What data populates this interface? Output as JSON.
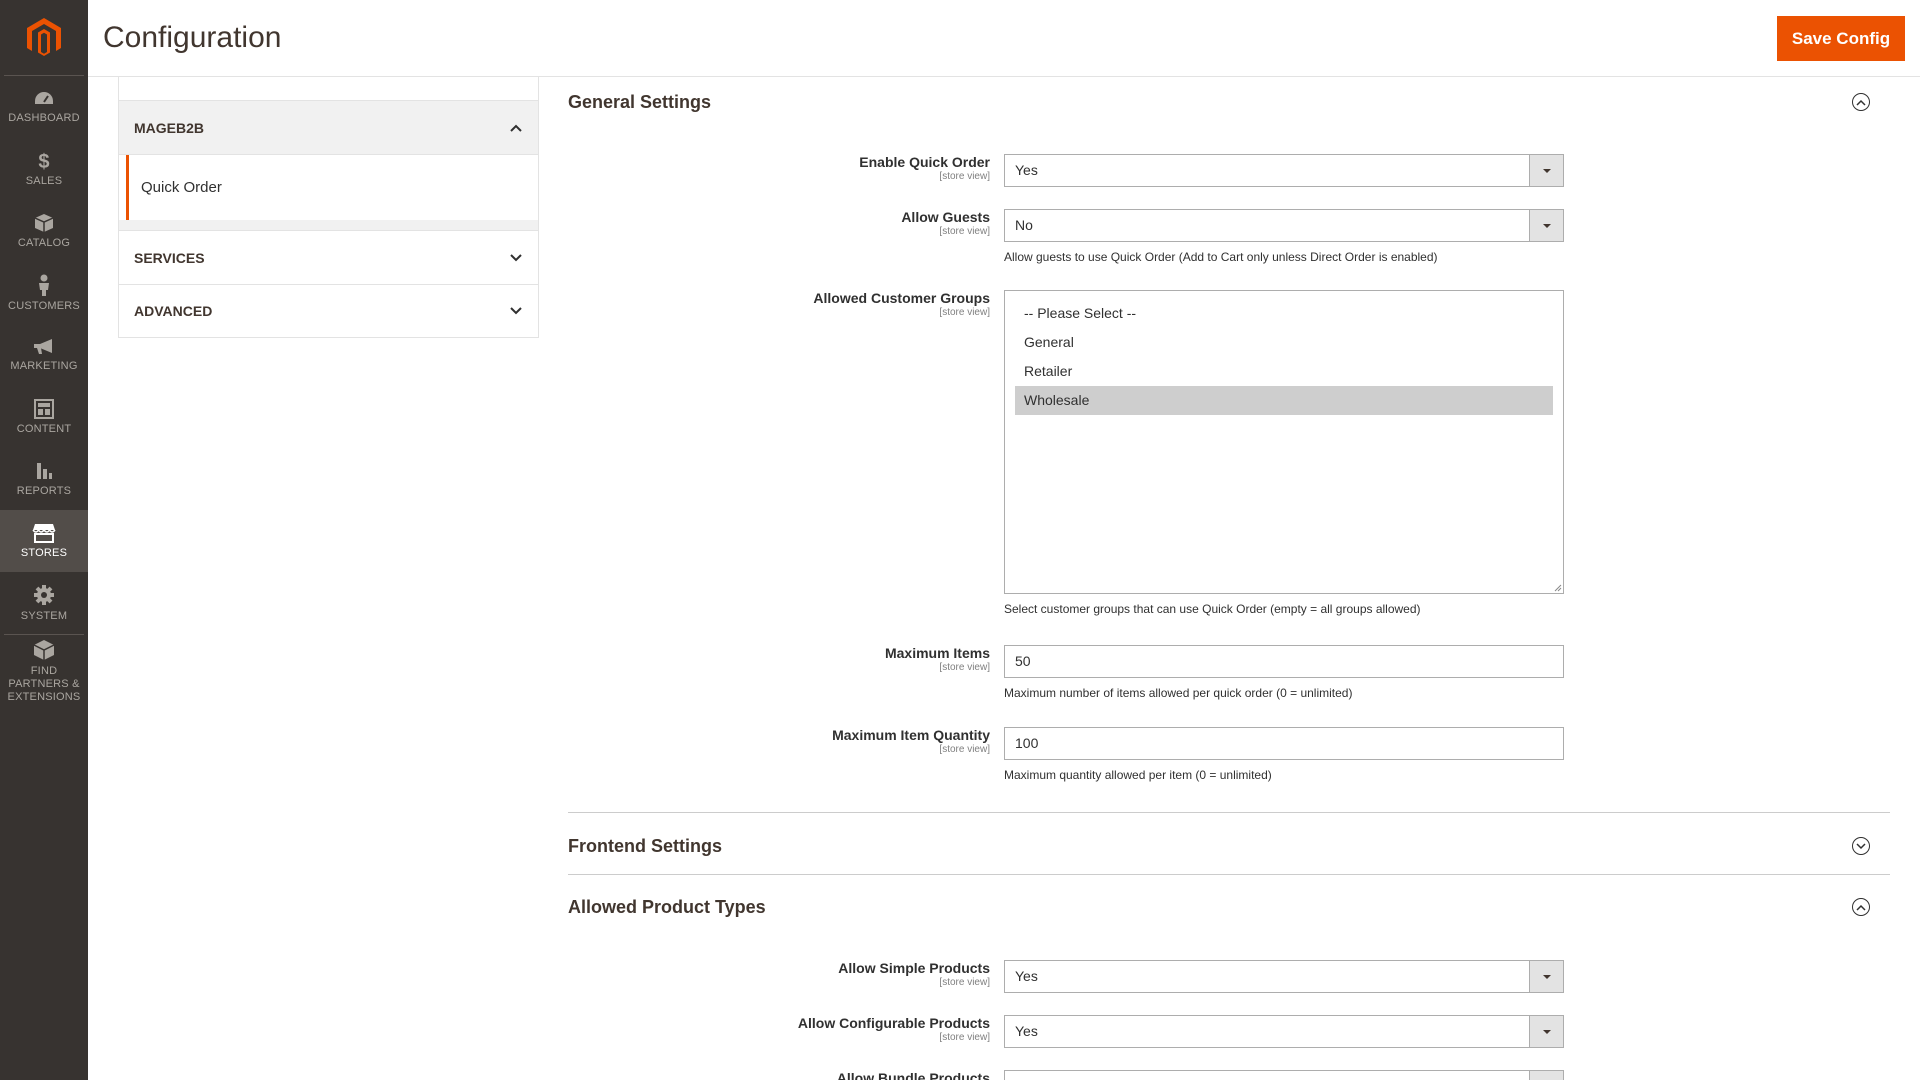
{
  "header": {
    "title": "Configuration",
    "save_label": "Save Config"
  },
  "colors": {
    "accent": "#eb5202",
    "sidebar_bg": "#373330"
  },
  "nav": [
    {
      "label": "DASHBOARD",
      "icon": "dashboard-icon"
    },
    {
      "label": "SALES",
      "icon": "dollar-icon"
    },
    {
      "label": "CATALOG",
      "icon": "box-icon"
    },
    {
      "label": "CUSTOMERS",
      "icon": "person-icon"
    },
    {
      "label": "MARKETING",
      "icon": "megaphone-icon"
    },
    {
      "label": "CONTENT",
      "icon": "layout-icon"
    },
    {
      "label": "REPORTS",
      "icon": "bar-chart-icon"
    },
    {
      "label": "STORES",
      "icon": "store-icon",
      "active": true
    },
    {
      "label": "SYSTEM",
      "icon": "gear-icon"
    },
    {
      "label": "FIND PARTNERS & EXTENSIONS",
      "icon": "cube-icon"
    }
  ],
  "config_tabs": {
    "group_open": "MAGEB2B",
    "active_item": "Quick Order",
    "group_services": "SERVICES",
    "group_advanced": "ADVANCED"
  },
  "sections": {
    "general": {
      "title": "General Settings",
      "fields": {
        "enable_quick_order": {
          "label": "Enable Quick Order",
          "scope": "[store view]",
          "value": "Yes"
        },
        "allow_guests": {
          "label": "Allow Guests",
          "scope": "[store view]",
          "value": "No",
          "note": "Allow guests to use Quick Order (Add to Cart only unless Direct Order is enabled)"
        },
        "allowed_groups": {
          "label": "Allowed Customer Groups",
          "scope": "[store view]",
          "options": [
            "-- Please Select --",
            "General",
            "Retailer",
            "Wholesale"
          ],
          "selected": "Wholesale",
          "note": "Select customer groups that can use Quick Order (empty = all groups allowed)"
        },
        "max_items": {
          "label": "Maximum Items",
          "scope": "[store view]",
          "value": "50",
          "note": "Maximum number of items allowed per quick order (0 = unlimited)"
        },
        "max_qty": {
          "label": "Maximum Item Quantity",
          "scope": "[store view]",
          "value": "100",
          "note": "Maximum quantity allowed per item (0 = unlimited)"
        }
      }
    },
    "frontend": {
      "title": "Frontend Settings"
    },
    "product_types": {
      "title": "Allowed Product Types",
      "fields": {
        "simple": {
          "label": "Allow Simple Products",
          "scope": "[store view]",
          "value": "Yes"
        },
        "configurable": {
          "label": "Allow Configurable Products",
          "scope": "[store view]",
          "value": "Yes"
        },
        "bundle": {
          "label": "Allow Bundle Products"
        }
      }
    }
  }
}
